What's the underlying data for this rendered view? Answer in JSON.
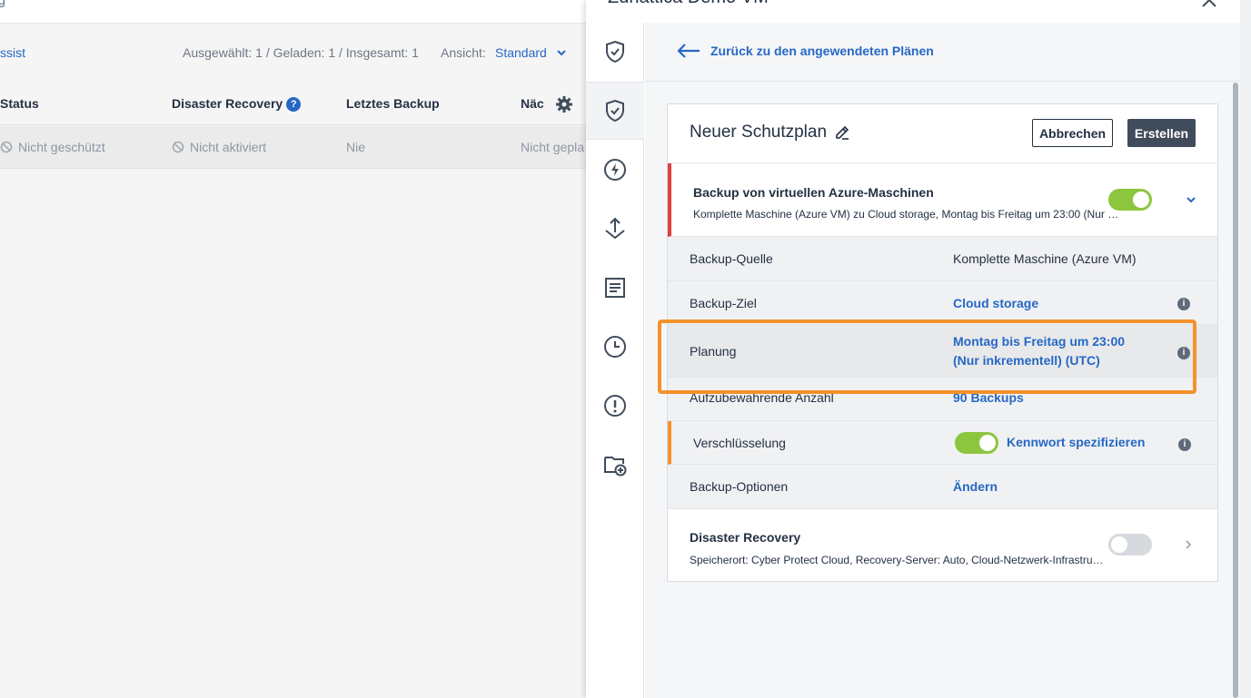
{
  "background": {
    "top_cut_text": "g",
    "assist_text": "ssist",
    "counts": "Ausgewählt: 1 / Geladen: 1 / Insgesamt: 1",
    "view_label": "Ansicht:",
    "view_value": "Standard",
    "columns": [
      "Status",
      "Disaster Recovery",
      "Letztes Backup",
      "Näc"
    ],
    "row": {
      "status": "Nicht geschützt",
      "disaster_recovery": "Nicht aktiviert",
      "last_backup": "Nie",
      "next": "Nicht gepla"
    }
  },
  "panel": {
    "title": "Zunattica Demo VM",
    "back_link": "Zurück zu den angewendeten Plänen",
    "plan_name": "Neuer Schutzplan",
    "cancel_label": "Abbrechen",
    "create_label": "Erstellen",
    "backup_section": {
      "title": "Backup von virtuellen Azure-Maschinen",
      "subtitle": "Komplette Maschine (Azure VM) zu Cloud storage, Montag bis Freitag um 23:00 (Nur inkrementell) (UTC)",
      "enabled": true
    },
    "rows": {
      "source": {
        "label": "Backup-Quelle",
        "value": "Komplette Maschine (Azure VM)"
      },
      "target": {
        "label": "Backup-Ziel",
        "value": "Cloud storage"
      },
      "schedule": {
        "label": "Planung",
        "value_line1": "Montag bis Freitag um 23:00",
        "value_line2": "(Nur inkrementell) (UTC)"
      },
      "retention": {
        "label": "Aufzubewahrende Anzahl",
        "value": "90 Backups"
      },
      "encryption": {
        "label": "Verschlüsselung",
        "value": "Kennwort spezifizieren",
        "enabled": true
      },
      "options": {
        "label": "Backup-Optionen",
        "value": "Ändern"
      }
    },
    "dr_section": {
      "title": "Disaster Recovery",
      "subtitle": "Speicherort: Cyber Protect Cloud, Recovery-Server: Auto, Cloud-Netzwerk-Infrastruktur",
      "enabled": false
    },
    "rail_icons": [
      "shield-check-icon",
      "shield-check-icon",
      "lightning-icon",
      "recovery-icon",
      "activities-icon",
      "clock-icon",
      "alert-icon",
      "folder-add-icon"
    ]
  },
  "colors": {
    "accent": "#2668c5",
    "toggle_on": "#8cc63f",
    "highlight": "#f4922b",
    "error_bar": "#e0403f"
  }
}
